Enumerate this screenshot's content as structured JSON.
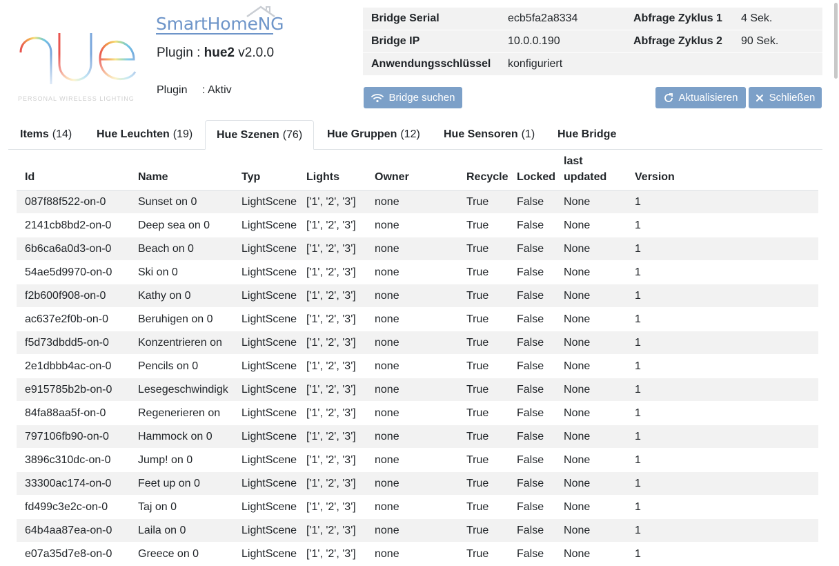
{
  "logo": {
    "word": "hue",
    "tagline": "PERSONAL WIRELESS LIGHTING"
  },
  "brand": {
    "name": "SmartHomeNG"
  },
  "plugin": {
    "prefix": "Plugin : ",
    "name": "hue2",
    "version": " v2.0.0",
    "status_label": "Plugin",
    "status_value": ": Aktiv"
  },
  "info": {
    "bridge_serial_label": "Bridge Serial",
    "bridge_serial": "ecb5fa2a8334",
    "cycle1_label": "Abfrage Zyklus 1",
    "cycle1": "4 Sek.",
    "bridge_ip_label": "Bridge IP",
    "bridge_ip": "10.0.0.190",
    "cycle2_label": "Abfrage Zyklus 2",
    "cycle2": "90 Sek.",
    "appkey_label": "Anwendungsschlüssel",
    "appkey": "konfiguriert"
  },
  "buttons": {
    "search": "Bridge suchen",
    "refresh": "Aktualisieren",
    "close": "Schließen"
  },
  "tabs": [
    {
      "name": "Items",
      "count": "(14)"
    },
    {
      "name": "Hue Leuchten",
      "count": "(19)"
    },
    {
      "name": "Hue Szenen",
      "count": "(76)"
    },
    {
      "name": "Hue Gruppen",
      "count": "(12)"
    },
    {
      "name": "Hue Sensoren",
      "count": "(1)"
    },
    {
      "name": "Hue Bridge",
      "count": ""
    }
  ],
  "table": {
    "columns": [
      "Id",
      "Name",
      "Typ",
      "Lights",
      "Owner",
      "Recycle",
      "Locked",
      "last updated",
      "Version"
    ],
    "rows": [
      [
        "087f88f522-on-0",
        "Sunset on 0",
        "LightScene",
        "['1', '2', '3']",
        "none",
        "True",
        "False",
        "None",
        "1"
      ],
      [
        "2141cb8bd2-on-0",
        "Deep sea on 0",
        "LightScene",
        "['1', '2', '3']",
        "none",
        "True",
        "False",
        "None",
        "1"
      ],
      [
        "6b6ca6a0d3-on-0",
        "Beach on 0",
        "LightScene",
        "['1', '2', '3']",
        "none",
        "True",
        "False",
        "None",
        "1"
      ],
      [
        "54ae5d9970-on-0",
        "Ski on 0",
        "LightScene",
        "['1', '2', '3']",
        "none",
        "True",
        "False",
        "None",
        "1"
      ],
      [
        "f2b600f908-on-0",
        "Kathy on 0",
        "LightScene",
        "['1', '2', '3']",
        "none",
        "True",
        "False",
        "None",
        "1"
      ],
      [
        "ac637e2f0b-on-0",
        "Beruhigen on 0",
        "LightScene",
        "['1', '2', '3']",
        "none",
        "True",
        "False",
        "None",
        "1"
      ],
      [
        "f5d73dbdd5-on-0",
        "Konzentrieren on",
        "LightScene",
        "['1', '2', '3']",
        "none",
        "True",
        "False",
        "None",
        "1"
      ],
      [
        "2e1dbbb4ac-on-0",
        "Pencils on 0",
        "LightScene",
        "['1', '2', '3']",
        "none",
        "True",
        "False",
        "None",
        "1"
      ],
      [
        "e915785b2b-on-0",
        "Lesegeschwindigk",
        "LightScene",
        "['1', '2', '3']",
        "none",
        "True",
        "False",
        "None",
        "1"
      ],
      [
        "84fa88aa5f-on-0",
        "Regenerieren on",
        "LightScene",
        "['1', '2', '3']",
        "none",
        "True",
        "False",
        "None",
        "1"
      ],
      [
        "797106fb90-on-0",
        "Hammock on 0",
        "LightScene",
        "['1', '2', '3']",
        "none",
        "True",
        "False",
        "None",
        "1"
      ],
      [
        "3896c310dc-on-0",
        "Jump! on 0",
        "LightScene",
        "['1', '2', '3']",
        "none",
        "True",
        "False",
        "None",
        "1"
      ],
      [
        "33300ac174-on-0",
        "Feet up on 0",
        "LightScene",
        "['1', '2', '3']",
        "none",
        "True",
        "False",
        "None",
        "1"
      ],
      [
        "fd499c3e2c-on-0",
        "Taj on 0",
        "LightScene",
        "['1', '2', '3']",
        "none",
        "True",
        "False",
        "None",
        "1"
      ],
      [
        "64b4aa87ea-on-0",
        "Laila on 0",
        "LightScene",
        "['1', '2', '3']",
        "none",
        "True",
        "False",
        "None",
        "1"
      ],
      [
        "e07a35d7e8-on-0",
        "Greece on 0",
        "LightScene",
        "['1', '2', '3']",
        "none",
        "True",
        "False",
        "None",
        "1"
      ]
    ]
  },
  "colors": {
    "button": "#7ca0c8",
    "brand": "#6e95c9",
    "stripe": "#f2f2f2"
  },
  "icons": {
    "search": "wifi-icon",
    "refresh": "refresh-icon",
    "close": "close-icon"
  }
}
